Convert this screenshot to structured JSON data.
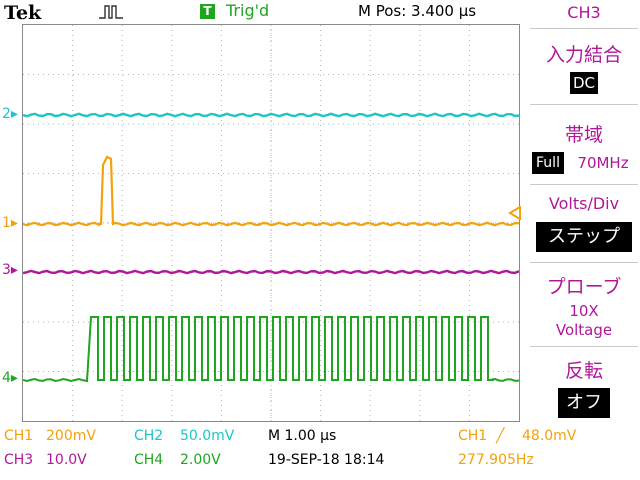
{
  "header": {
    "logo": "Tek",
    "trigger_box": "T",
    "trigger_state": "Trig'd",
    "m_pos": "M Pos: 3.400 µs"
  },
  "menu": {
    "channel": "CH3",
    "items": [
      {
        "title": "入力結合",
        "value": "DC"
      },
      {
        "title": "帯域",
        "value_box": "Full",
        "value": "70MHz"
      },
      {
        "title": "Volts/Div",
        "value": "ステップ"
      },
      {
        "title": "プローブ",
        "value_line1": "10X",
        "value_line2": "Voltage"
      },
      {
        "title": "反転",
        "value": "オフ"
      }
    ]
  },
  "channels": {
    "ch1": {
      "label": "CH1",
      "scale": "200mV",
      "color": "#f2a20d",
      "marker": "1"
    },
    "ch2": {
      "label": "CH2",
      "scale": "50.0mV",
      "color": "#1ec4c8",
      "marker": "2"
    },
    "ch3": {
      "label": "CH3",
      "scale": "10.0V",
      "color": "#b0189a",
      "marker": "3"
    },
    "ch4": {
      "label": "CH4",
      "scale": "2.00V",
      "color": "#1fa61f",
      "marker": "4"
    }
  },
  "status": {
    "timebase": "M 1.00 µs",
    "date_time": "19-SEP-18 18:14",
    "trigger_ch": "CH1",
    "trigger_slope": "╱",
    "trigger_level": "48.0mV",
    "frequency": "277.905Hz"
  }
}
